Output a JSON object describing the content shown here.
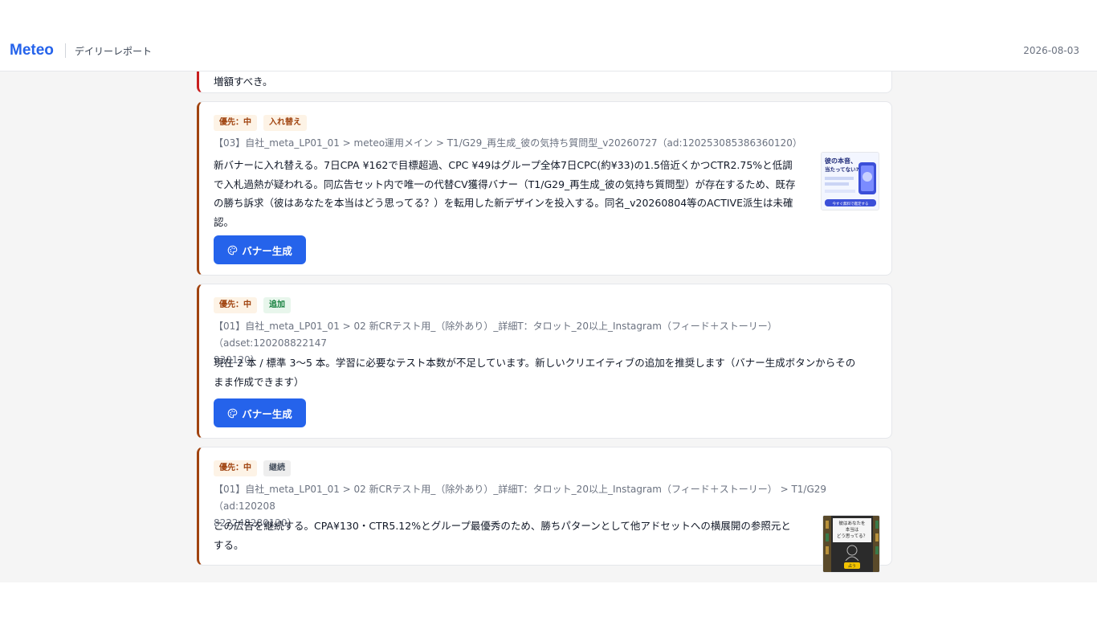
{
  "header": {
    "brand": "Meteo",
    "subtitle": "デイリーレポート",
    "date": "2026-08-03"
  },
  "cards": [
    {
      "text": "増額すべき。"
    },
    {
      "badges": {
        "priority": "優先：中",
        "action": "入れ替え"
      },
      "path": "【03】自社_meta_LP01_01 > meteo運用メイン > T1/G29_再生成_彼の気持ち質問型_v20260727（ad:120253085386360120）",
      "text_lines": [
        "新バナーに入れ替える。7日CPA ¥162で目標超過、CPC ¥49はグループ全体7日CPC(約¥33)の1.5倍近くかつCTR2.75%と低調",
        "で入札過熱が疑われる。同広告セット内で唯一の代替CV獲得バナー（T1/G29_再生成_彼の気持ち質問型）が存在するため、既存",
        "の勝ち訴求（彼はあなたを本当はどう思ってる？）を転用した新デザインを投入する。同名_v20260804等のACTIVE派生は未確",
        "認。"
      ],
      "button": "バナー生成",
      "thumbnail": {
        "headline": "彼の本音、",
        "headline2": "当たってない?",
        "cta": "今すぐ無料で鑑定する"
      }
    },
    {
      "badges": {
        "priority": "優先：中",
        "action": "追加"
      },
      "path_lines": [
        "【01】自社_meta_LP01_01 > 02 新CRテスト用_（除外あり）_詳細T：タロット_20以上_Instagram（フィード＋ストーリー）（adset:120208822147",
        "930120）"
      ],
      "text_lines": [
        "現在 2 本 / 標準 3〜5 本。学習に必要なテスト本数が不足しています。新しいクリエイティブの追加を推奨します（バナー生成ボタンからその",
        "まま作成できます）"
      ],
      "button": "バナー生成"
    },
    {
      "badges": {
        "priority": "優先：中",
        "action": "継続"
      },
      "path_lines": [
        "【01】自社_meta_LP01_01 > 02 新CRテスト用_（除外あり）_詳細T：タロット_20以上_Instagram（フィード＋ストーリー） > T1/G29（ad:120208",
        "822248280120）"
      ],
      "text_lines": [
        "この広告を継続する。CPA¥130・CTR5.12%とグループ最優秀のため、勝ちパターンとして他アドセットへの横展開の参照元と",
        "する。"
      ],
      "thumbnail": {
        "line1": "彼はあなたを",
        "line2": "本当は",
        "line3": "どう思ってる？",
        "cta": "占う"
      }
    }
  ],
  "colors": {
    "accent": "#2563eb",
    "priority_border": "#a0430f",
    "prev_border": "#c81e1e"
  }
}
